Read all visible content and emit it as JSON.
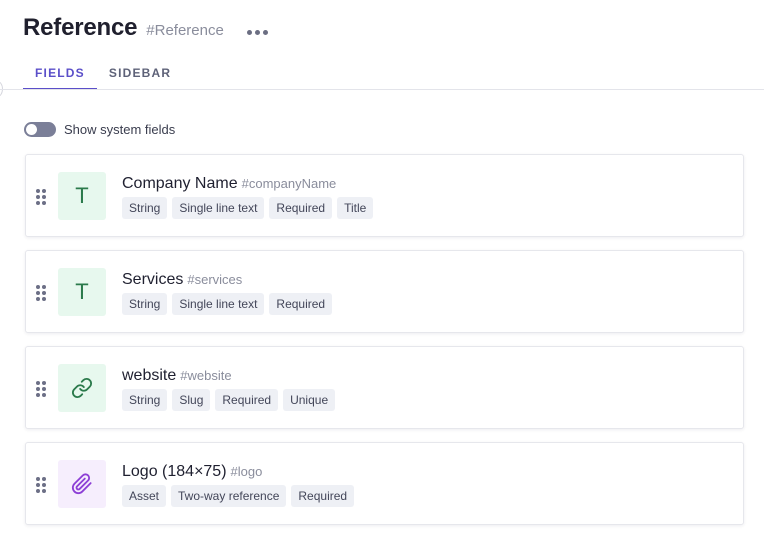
{
  "header": {
    "title": "Reference",
    "api_id": "#Reference",
    "more_icon": "more-horizontal-icon"
  },
  "tabs": [
    {
      "label": "FIELDS",
      "active": true
    },
    {
      "label": "SIDEBAR",
      "active": false
    }
  ],
  "system_fields_toggle": {
    "label": "Show system fields",
    "enabled": false
  },
  "colors": {
    "accent": "#5b4fc9",
    "green_icon_bg": "#e7f8ee",
    "green_icon_fg": "#2b7a4b",
    "purple_icon_bg": "#f6eefd",
    "purple_icon_fg": "#8d3fd6"
  },
  "fields": [
    {
      "name": "Company Name",
      "api_id": "#companyName",
      "icon": "text-type-icon",
      "icon_letter": "T",
      "badges": [
        "String",
        "Single line text",
        "Required",
        "Title"
      ]
    },
    {
      "name": "Services",
      "api_id": "#services",
      "icon": "text-type-icon",
      "icon_letter": "T",
      "badges": [
        "String",
        "Single line text",
        "Required"
      ]
    },
    {
      "name": "website",
      "api_id": "#website",
      "icon": "link-icon",
      "badges": [
        "String",
        "Slug",
        "Required",
        "Unique"
      ]
    },
    {
      "name": "Logo (184×75)",
      "api_id": "#logo",
      "icon": "paperclip-icon",
      "badges": [
        "Asset",
        "Two-way reference",
        "Required"
      ]
    }
  ]
}
